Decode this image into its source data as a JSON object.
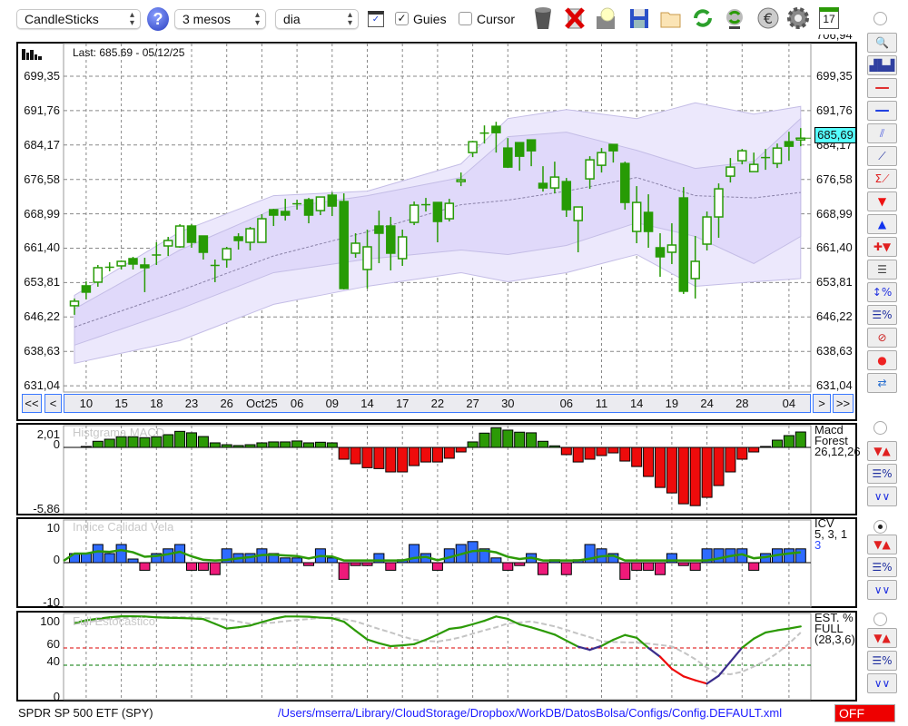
{
  "toolbar": {
    "chart_type": "CandleSticks",
    "period": "3 mesos",
    "interval": "dia",
    "guies_label": "Guies",
    "guies_checked": true,
    "cursor_label": "Cursor",
    "cursor_checked": false,
    "icons": [
      "help-icon",
      "chart-window-icon",
      "trash-icon",
      "delete-icon",
      "lamp-icon",
      "save-icon",
      "folder-icon",
      "refresh-icon",
      "sync-icon",
      "euro-icon",
      "gear-icon",
      "calendar-icon"
    ],
    "calendar_day": "17"
  },
  "main": {
    "last_label": "Last: 685.69 - 05/12/25",
    "top_tick": "706,94",
    "price_ticks": [
      "699,35",
      "691,76",
      "684,17",
      "676,58",
      "668,99",
      "661,40",
      "653,81",
      "646,22",
      "638,63",
      "631,04"
    ],
    "price_values": [
      699.35,
      691.76,
      684.17,
      676.58,
      668.99,
      661.4,
      653.81,
      646.22,
      638.63,
      631.04
    ],
    "current_price": "685,69",
    "current_price_value": 685.69,
    "current_price_color": "#55ffff",
    "nav": {
      "first": "<<",
      "prev": "<",
      "next": ">",
      "last": ">>"
    },
    "dates": [
      {
        "i": 1,
        "t": "10"
      },
      {
        "i": 4,
        "t": "15"
      },
      {
        "i": 7,
        "t": "18"
      },
      {
        "i": 10,
        "t": "23"
      },
      {
        "i": 13,
        "t": "26"
      },
      {
        "i": 16,
        "t": "Oct25"
      },
      {
        "i": 19,
        "t": "06"
      },
      {
        "i": 22,
        "t": "09"
      },
      {
        "i": 25,
        "t": "14"
      },
      {
        "i": 28,
        "t": "17"
      },
      {
        "i": 31,
        "t": "22"
      },
      {
        "i": 34,
        "t": "27"
      },
      {
        "i": 37,
        "t": "30"
      },
      {
        "i": 42,
        "t": "06"
      },
      {
        "i": 45,
        "t": "11"
      },
      {
        "i": 48,
        "t": "14"
      },
      {
        "i": 51,
        "t": "19"
      },
      {
        "i": 54,
        "t": "24"
      },
      {
        "i": 57,
        "t": "28"
      },
      {
        "i": 61,
        "t": "04"
      }
    ]
  },
  "chart_data": [
    {
      "type": "candlestick",
      "ylim": [
        631.04,
        706.94
      ],
      "color_candle": "#279b05",
      "band_colors": [
        "#ece8fc",
        "#e0d9fa"
      ],
      "candles": [
        [
          648.7,
          650.3,
          646.7,
          649.7
        ],
        [
          653.1,
          654.1,
          650.1,
          651.7
        ],
        [
          653.9,
          657.7,
          652.9,
          657.1
        ],
        [
          657.1,
          658.3,
          656.3,
          657.2
        ],
        [
          657.5,
          658.7,
          656.7,
          658.5
        ],
        [
          659.1,
          659.5,
          656.7,
          657.9
        ],
        [
          657.7,
          659.3,
          651.7,
          657.1
        ],
        [
          659.8,
          662.7,
          657.7,
          659.9
        ],
        [
          661.9,
          663.9,
          659.7,
          663.1
        ],
        [
          661.7,
          666.7,
          661.5,
          666.3
        ],
        [
          666.3,
          666.7,
          661.5,
          662.7
        ],
        [
          664.1,
          664.1,
          658.9,
          660.5
        ],
        [
          657.5,
          658.9,
          653.9,
          657.6
        ],
        [
          658.9,
          661.7,
          657.1,
          661.3
        ],
        [
          663.9,
          664.7,
          661.1,
          663.1
        ],
        [
          662.7,
          666.1,
          660.9,
          665.7
        ],
        [
          662.7,
          668.9,
          662.7,
          667.9
        ],
        [
          669.9,
          670.1,
          666.3,
          668.7
        ],
        [
          669.5,
          672.3,
          667.5,
          668.7
        ],
        [
          671.1,
          672.1,
          669.9,
          671.2
        ],
        [
          672.1,
          672.5,
          666.9,
          668.7
        ],
        [
          669.7,
          672.7,
          668.7,
          672.7
        ],
        [
          673.1,
          673.7,
          668.5,
          670.7
        ],
        [
          671.7,
          673.5,
          652.3,
          652.5
        ],
        [
          660.3,
          664.7,
          659.3,
          662.5
        ],
        [
          656.7,
          665.5,
          652.5,
          661.7
        ],
        [
          666.3,
          669.7,
          658.1,
          664.7
        ],
        [
          666.3,
          668.3,
          656.5,
          660.3
        ],
        [
          659.1,
          665.5,
          657.5,
          663.9
        ],
        [
          667.1,
          671.7,
          666.5,
          670.9
        ],
        [
          670.9,
          672.5,
          669.5,
          671.0
        ],
        [
          671.5,
          671.5,
          662.7,
          667.3
        ],
        [
          667.9,
          672.3,
          667.3,
          671.3
        ],
        [
          676.1,
          678.1,
          675.1,
          676.5
        ],
        [
          682.5,
          685.1,
          681.5,
          684.9
        ],
        [
          686.7,
          688.5,
          684.5,
          686.8
        ],
        [
          688.3,
          689.3,
          682.5,
          686.9
        ],
        [
          683.5,
          685.7,
          679.1,
          679.3
        ],
        [
          684.7,
          684.7,
          678.5,
          681.7
        ],
        [
          685.3,
          685.3,
          679.5,
          682.9
        ],
        [
          675.7,
          679.5,
          673.9,
          674.7
        ],
        [
          674.7,
          680.5,
          673.5,
          677.1
        ],
        [
          676.1,
          676.9,
          668.3,
          669.9
        ],
        [
          667.5,
          670.5,
          660.5,
          670.5
        ],
        [
          676.7,
          681.7,
          674.5,
          680.9
        ],
        [
          679.7,
          683.5,
          678.1,
          682.5
        ],
        [
          684.3,
          684.3,
          680.3,
          682.9
        ],
        [
          680.1,
          680.5,
          669.9,
          671.5
        ],
        [
          665.1,
          675.1,
          662.5,
          671.5
        ],
        [
          669.3,
          673.3,
          661.5,
          665.1
        ],
        [
          661.5,
          664.7,
          655.1,
          659.5
        ],
        [
          660.5,
          666.9,
          657.9,
          662.1
        ],
        [
          672.5,
          674.9,
          651.3,
          651.9
        ],
        [
          654.7,
          664.1,
          650.3,
          658.5
        ],
        [
          662.3,
          669.5,
          660.9,
          668.3
        ],
        [
          668.3,
          675.7,
          663.7,
          674.5
        ],
        [
          677.3,
          681.3,
          675.9,
          679.3
        ],
        [
          680.7,
          683.3,
          679.9,
          682.9
        ],
        [
          678.3,
          682.5,
          678.3,
          679.9
        ],
        [
          681.3,
          683.3,
          678.7,
          681.4
        ],
        [
          680.1,
          684.5,
          679.1,
          683.5
        ],
        [
          684.9,
          687.1,
          680.7,
          683.9
        ],
        [
          685.3,
          687.9,
          683.9,
          685.69
        ]
      ],
      "bands": [
        {
          "i": 0,
          "u2": 651,
          "u1": 648,
          "m": 644,
          "l1": 640,
          "l2": 636
        },
        {
          "i": 9,
          "u2": 665,
          "u1": 661,
          "m": 652,
          "l1": 648,
          "l2": 641
        },
        {
          "i": 17,
          "u2": 673,
          "u1": 670,
          "m": 659.7,
          "l1": 656,
          "l2": 649
        },
        {
          "i": 25,
          "u2": 674,
          "u1": 673,
          "m": 665,
          "l1": 659,
          "l2": 653
        },
        {
          "i": 33,
          "u2": 680,
          "u1": 677,
          "m": 671,
          "l1": 661,
          "l2": 656
        },
        {
          "i": 37,
          "u2": 690,
          "u1": 686,
          "m": 672,
          "l1": 660,
          "l2": 654
        },
        {
          "i": 42,
          "u2": 692,
          "u1": 687,
          "m": 674,
          "l1": 662,
          "l2": 656
        },
        {
          "i": 48,
          "u2": 690,
          "u1": 683,
          "m": 677,
          "l1": 667,
          "l2": 660
        },
        {
          "i": 53,
          "u2": 693.5,
          "u1": 679,
          "m": 673,
          "l1": 664,
          "l2": 653
        },
        {
          "i": 58,
          "u2": 691,
          "u1": 680.5,
          "m": 672.5,
          "l1": 658,
          "l2": 654
        },
        {
          "i": 62,
          "u2": 692.7,
          "u1": 690,
          "m": 673.7,
          "l1": 664,
          "l2": 654.7
        }
      ]
    },
    {
      "type": "bar",
      "title": "Histgrama MACD",
      "ylim": [
        -5.86,
        2.01
      ],
      "colors": {
        "pos": "#2c9a06",
        "neg": "#ee0b0b"
      },
      "values": [
        0,
        0.09,
        0.59,
        0.79,
        1.03,
        1.03,
        0.94,
        1.03,
        1.23,
        1.55,
        1.41,
        1.05,
        0.44,
        0.26,
        0.18,
        0.26,
        0.44,
        0.53,
        0.53,
        0.62,
        0.44,
        0.5,
        0.44,
        -1.14,
        -1.58,
        -1.96,
        -2.05,
        -2.37,
        -2.37,
        -1.76,
        -1.41,
        -1.41,
        -1.05,
        -0.44,
        0.53,
        1.38,
        1.9,
        1.67,
        1.47,
        1.41,
        0.59,
        0.15,
        -0.7,
        -1.41,
        -1.14,
        -0.79,
        -0.53,
        -1.32,
        -1.85,
        -2.81,
        -3.87,
        -4.4,
        -5.45,
        -5.63,
        -4.83,
        -3.69,
        -2.37,
        -1.14,
        -0.44,
        0.09,
        0.7,
        1.14,
        1.49
      ]
    },
    {
      "type": "bar",
      "title": "Indice Calidad Vela",
      "ylim": [
        -10,
        10
      ],
      "colors": {
        "pos": "#2e6bff",
        "neg": "#ee1a7a",
        "line": "#2c9a06"
      },
      "values": [
        2.5,
        2.5,
        5,
        2.5,
        5,
        1,
        -2.1,
        2.5,
        3.8,
        5,
        -2.1,
        -2.1,
        -3.3,
        3.8,
        2.5,
        2.5,
        3.8,
        2.5,
        1.3,
        1.3,
        -0.8,
        3.8,
        1.3,
        -4.6,
        -0.8,
        -0.8,
        2.5,
        -2.1,
        0.8,
        5,
        2.5,
        -2.1,
        3.8,
        5,
        5.8,
        3.8,
        1.3,
        -2.1,
        -0.8,
        2.5,
        -3.3,
        0.8,
        -3.3,
        0.8,
        5,
        3.8,
        2.5,
        -4.6,
        -2.1,
        -2.1,
        -3.3,
        2.5,
        -0.8,
        -2.1,
        3.8,
        3.8,
        3.8,
        3.8,
        -2.1,
        2.5,
        3.8,
        3.8,
        3.8
      ]
    },
    {
      "type": "line",
      "title": "Full Estocastico",
      "ylim": [
        0,
        100
      ],
      "levels": [
        {
          "v": 60,
          "color": "#dd0000"
        },
        {
          "v": 40,
          "color": "#007700"
        }
      ],
      "series": [
        {
          "values": [
            89,
            92,
            94,
            95.5,
            96.7,
            96.8,
            96.5,
            95.5,
            95,
            94.7,
            94.3,
            93.5,
            88,
            82.5,
            84,
            86,
            90,
            93.8,
            96.5,
            96.5,
            96.2,
            95.2,
            94.5,
            90.5,
            80,
            69.8,
            65.5,
            62.1,
            63,
            64.4,
            69.6,
            75.5,
            82.1,
            83.8,
            87.5,
            91.5,
            96.5,
            93.7,
            87.3,
            83.9,
            79.8,
            75.5,
            68.5,
            61.5,
            57.8,
            62.4,
            69.5,
            75,
            71.8,
            60,
            49.8,
            35.8,
            27,
            22.5,
            18.6,
            27.7,
            44,
            60.3,
            70.8,
            77.9,
            80.5,
            82.5,
            84.9
          ],
          "color": "#2c9a06",
          "zones": [
            {
              "from": 43,
              "to": 45,
              "color": "#3a2d8c"
            },
            {
              "from": 49,
              "to": 50,
              "color": "#3a2d8c"
            },
            {
              "from": 50,
              "to": 54,
              "color": "#ee0b0b"
            },
            {
              "from": 54,
              "to": 57,
              "color": "#3a2d8c"
            }
          ]
        },
        {
          "values": [
            88,
            89.5,
            92,
            93.5,
            94.5,
            95.2,
            95.8,
            95.8,
            95.8,
            95.8,
            95.8,
            95,
            94,
            93,
            90.5,
            88,
            88.5,
            89.4,
            91,
            92.5,
            93.5,
            95,
            95.3,
            93.5,
            90.8,
            86.5,
            82,
            78,
            73.5,
            69.5,
            68,
            67.5,
            69.5,
            72.5,
            76.5,
            80.5,
            84,
            88.4,
            89.5,
            90.8,
            88,
            85,
            81,
            76.5,
            72.5,
            67.8,
            67,
            66.6,
            66.2,
            65,
            63.5,
            61.8,
            55,
            47,
            37,
            30.5,
            29.5,
            32.3,
            38.5,
            45,
            54,
            65,
            77.9
          ],
          "color": "#c4c4c4",
          "dashed": true
        }
      ]
    }
  ],
  "macd": {
    "title": "Histgrama MACD",
    "ticks": [
      "2,01",
      "0",
      "-5,86"
    ],
    "legend": [
      "Macd",
      "Forest",
      "26,12,26"
    ]
  },
  "icv": {
    "title": "Indice Calidad Vela",
    "ticks": [
      "10",
      "0",
      "-10"
    ],
    "legend": [
      "ICV",
      "5, 3, 1",
      "3"
    ]
  },
  "stoch": {
    "title": "Full Estocastico",
    "ticks": [
      "100",
      "60",
      "40",
      "0"
    ],
    "legend": [
      "EST. %",
      "FULL",
      "(28,3,6)"
    ]
  },
  "sidebar": {
    "main_tools": [
      "zoom-icon",
      "volume-chart-icon",
      "red-line-icon",
      "blue-line-icon",
      "channel-icon",
      "trendline-icon",
      "sum-trendline-icon",
      "sell-arrow-icon",
      "buy-arrow-icon",
      "add-signal-icon",
      "grid-lines-icon",
      "range-percent-icon",
      "percent-lines-icon",
      "no-entry-icon",
      "record-icon",
      "swap-icon"
    ],
    "panel_tools": [
      "signals-icon",
      "percent-lines-icon",
      "oscillator-icon"
    ],
    "selected_panel": "icv"
  },
  "status": {
    "symbol": "SPDR SP 500 ETF (SPY)",
    "path": "/Users/mserra/Library/CloudStorage/Dropbox/WorkDB/DatosBolsa/Configs/Config.DEFAULT.xml",
    "off_label": "OFF",
    "off_color": "#ee0000"
  }
}
